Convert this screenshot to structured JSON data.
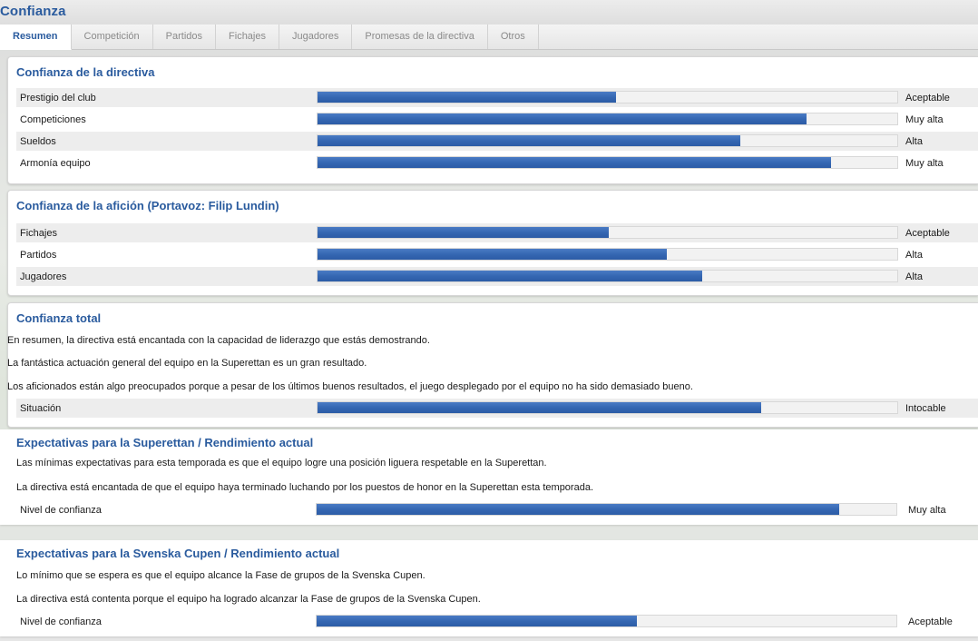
{
  "title": "Confianza",
  "tabs": [
    {
      "label": "Resumen",
      "active": true
    },
    {
      "label": "Competición",
      "active": false
    },
    {
      "label": "Partidos",
      "active": false
    },
    {
      "label": "Fichajes",
      "active": false
    },
    {
      "label": "Jugadores",
      "active": false
    },
    {
      "label": "Promesas de la directiva",
      "active": false
    },
    {
      "label": "Otros",
      "active": false
    }
  ],
  "directiva": {
    "title": "Confianza de la directiva",
    "rows": [
      {
        "label": "Prestigio del club",
        "level": 0.515,
        "value": "Aceptable"
      },
      {
        "label": "Competiciones",
        "level": 0.843,
        "value": "Muy alta"
      },
      {
        "label": "Sueldos",
        "level": 0.73,
        "value": "Alta"
      },
      {
        "label": "Armonía equipo",
        "level": 0.886,
        "value": "Muy alta"
      }
    ]
  },
  "aficion": {
    "title": "Confianza de la afición (Portavoz: Filip Lundin)",
    "rows": [
      {
        "label": "Fichajes",
        "level": 0.502,
        "value": "Aceptable"
      },
      {
        "label": "Partidos",
        "level": 0.602,
        "value": "Alta"
      },
      {
        "label": "Jugadores",
        "level": 0.664,
        "value": "Alta"
      }
    ]
  },
  "total": {
    "title": "Confianza total",
    "paragraphs": [
      "En resumen, la directiva está encantada con la capacidad de liderazgo que estás demostrando.",
      "La fantástica actuación general del equipo en la Superettan es un gran resultado.",
      "Los aficionados están algo preocupados porque a pesar de los últimos buenos resultados, el juego desplegado por el equipo no ha sido demasiado bueno."
    ],
    "row": {
      "label": "Situación",
      "level": 0.765,
      "value": "Intocable"
    }
  },
  "superettan": {
    "title": "Expectativas para la Superettan / Rendimiento actual",
    "paragraphs": [
      "Las mínimas expectativas para esta temporada es que el equipo logre una posición liguera respetable en la Superettan.",
      "La directiva está encantada de que el equipo haya terminado luchando por los puestos de honor en la Superettan esta temporada."
    ],
    "row": {
      "label": "Nivel de confianza",
      "level": 0.902,
      "value": "Muy alta"
    }
  },
  "cupen": {
    "title": "Expectativas para la Svenska Cupen / Rendimiento actual",
    "paragraphs": [
      "Lo mínimo que se espera es que el equipo alcance la Fase de grupos de la Svenska Cupen.",
      "La directiva está contenta porque el equipo ha logrado alcanzar la Fase de grupos de la Svenska Cupen."
    ],
    "row": {
      "label": "Nivel de confianza",
      "level": 0.552,
      "value": "Aceptable"
    }
  },
  "colors": {
    "accent": "#2a5b9e",
    "bar": "#3567b2"
  }
}
